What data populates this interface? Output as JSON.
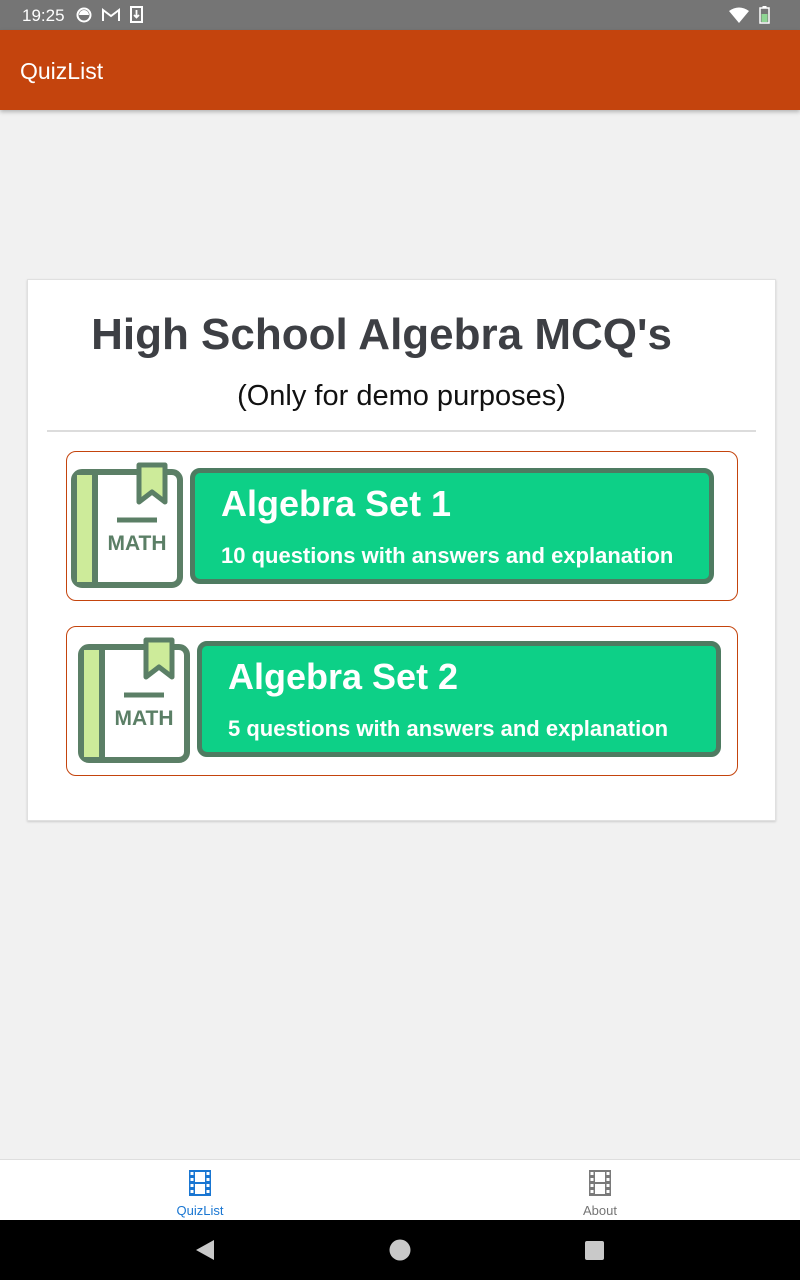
{
  "status_bar": {
    "time": "19:25",
    "left_icons": [
      "sync-icon",
      "gmail-icon",
      "download-icon"
    ],
    "right_icons": [
      "wifi-icon",
      "battery-icon"
    ]
  },
  "app_bar": {
    "title": "QuizList"
  },
  "card": {
    "title": "High School Algebra MCQ's",
    "subtitle": "(Only for demo purposes)",
    "quizzes": [
      {
        "name": "Algebra Set 1",
        "description": "10 questions with answers and explanation",
        "icon": "math-book-icon",
        "icon_label": "MATH"
      },
      {
        "name": "Algebra Set 2",
        "description": "5 questions with answers and explanation",
        "icon": "math-book-icon",
        "icon_label": "MATH"
      }
    ]
  },
  "bottom_nav": {
    "items": [
      {
        "label": "QuizList",
        "icon": "film-icon",
        "active": true
      },
      {
        "label": "About",
        "icon": "film-icon",
        "active": false
      }
    ]
  },
  "system_nav": {
    "buttons": [
      "back-button",
      "home-button",
      "recents-button"
    ]
  },
  "colors": {
    "app_bar": "#c4440d",
    "quiz_panel": "#0dd087",
    "quiz_panel_border": "#4e7b61",
    "active_nav": "#1976d2"
  }
}
